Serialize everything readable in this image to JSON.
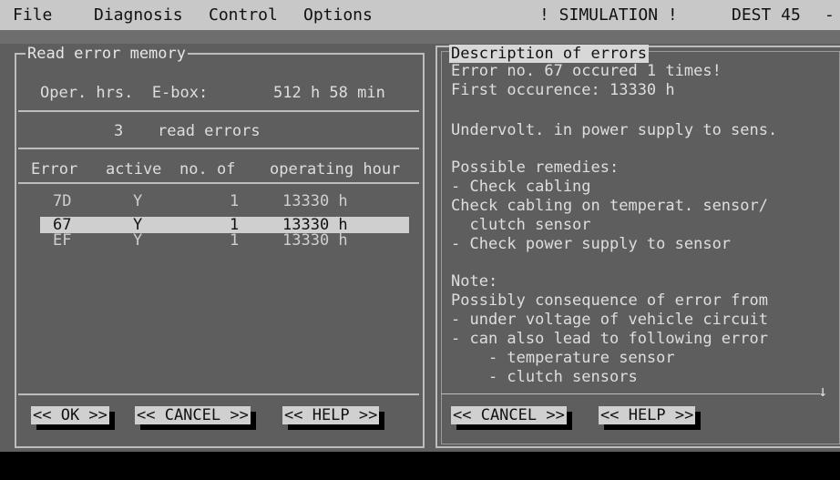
{
  "menu": {
    "items": [
      "File",
      "Diagnosis",
      "Control",
      "Options"
    ],
    "mode": "! SIMULATION !",
    "device": "DEST 45",
    "extra": "-"
  },
  "left_panel": {
    "title": "Read error memory",
    "oper_label": "Oper. hrs.  E-box:",
    "oper_value": "512 h 58 min",
    "read_count": "3",
    "read_label": "read errors",
    "columns": [
      "Error",
      "active",
      "no. of",
      "operating hour"
    ],
    "rows": [
      {
        "code": "7D",
        "active": "Y",
        "count": "1",
        "hours": "13330 h"
      },
      {
        "code": "67",
        "active": "Y",
        "count": "1",
        "hours": "13330 h"
      },
      {
        "code": "EF",
        "active": "Y",
        "count": "1",
        "hours": "13330 h"
      }
    ],
    "selected_row": 1,
    "buttons": {
      "ok": "<< OK >>",
      "cancel": "<< CANCEL >>",
      "help": "<< HELP >>"
    }
  },
  "right_panel": {
    "title": "Description of errors",
    "lines": [
      "Error no. 67 occured 1 times!",
      "First occurence: 13330 h",
      "",
      "Undervolt. in power supply to sens.",
      "",
      "Possible remedies:",
      "- Check cabling",
      "Check cabling on temperat. sensor/",
      "  clutch sensor",
      "- Check power supply to sensor",
      "",
      "Note:",
      "Possibly consequence of error from",
      "- under voltage of vehicle circuit",
      "- can also lead to following error",
      "    - temperature sensor",
      "    - clutch sensors"
    ],
    "scroll_arrow": "↓",
    "buttons": {
      "cancel": "<< CANCEL >>",
      "help": "<< HELP >>"
    }
  }
}
